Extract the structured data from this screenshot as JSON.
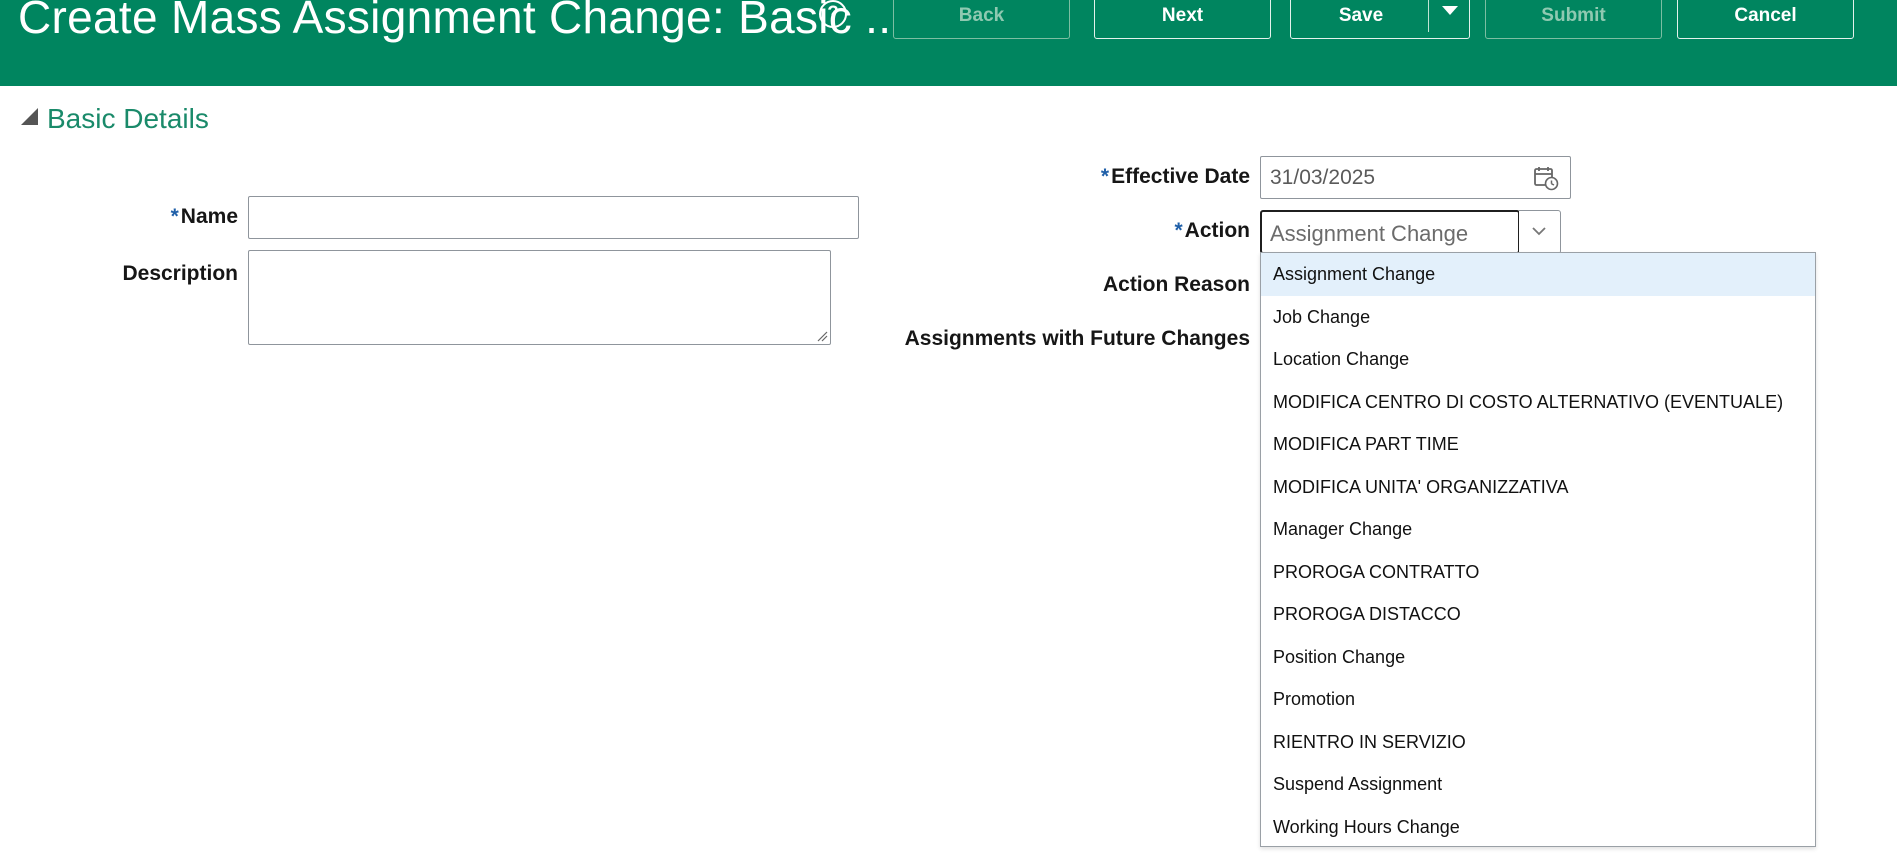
{
  "header": {
    "title": "Create Mass Assignment Change: Basic ...",
    "help_icon": "?",
    "buttons": {
      "back": "Back",
      "next": "Next",
      "save": "Save",
      "submit": "Submit",
      "cancel": "Cancel"
    }
  },
  "section": {
    "title": "Basic Details"
  },
  "form": {
    "name_label": "Name",
    "name_value": "",
    "description_label": "Description",
    "description_value": "",
    "effective_date_label": "Effective Date",
    "effective_date_value": "31/03/2025",
    "action_label": "Action",
    "action_value": "Assignment Change",
    "action_reason_label": "Action Reason",
    "future_changes_label": "Assignments with Future Changes",
    "required_marker": "*"
  },
  "action_options": [
    "Assignment Change",
    "Job Change",
    "Location Change",
    "MODIFICA CENTRO DI COSTO ALTERNATIVO (EVENTUALE)",
    "MODIFICA PART TIME",
    "MODIFICA UNITA' ORGANIZZATIVA",
    "Manager Change",
    "PROROGA CONTRATTO",
    "PROROGA DISTACCO",
    "Position Change",
    "Promotion",
    "RIENTRO IN SERVIZIO",
    "Suspend Assignment",
    "Working Hours Change"
  ],
  "colors": {
    "header_bg": "#00855f",
    "section_title": "#1a8a6a",
    "required": "#1f5fa8",
    "selected_option_bg": "#e3f0fb"
  },
  "icons": {
    "help": "help-icon",
    "calendar": "calendar-icon",
    "dropdown": "chevron-down-icon",
    "section_toggle": "triangle-collapse-icon"
  }
}
